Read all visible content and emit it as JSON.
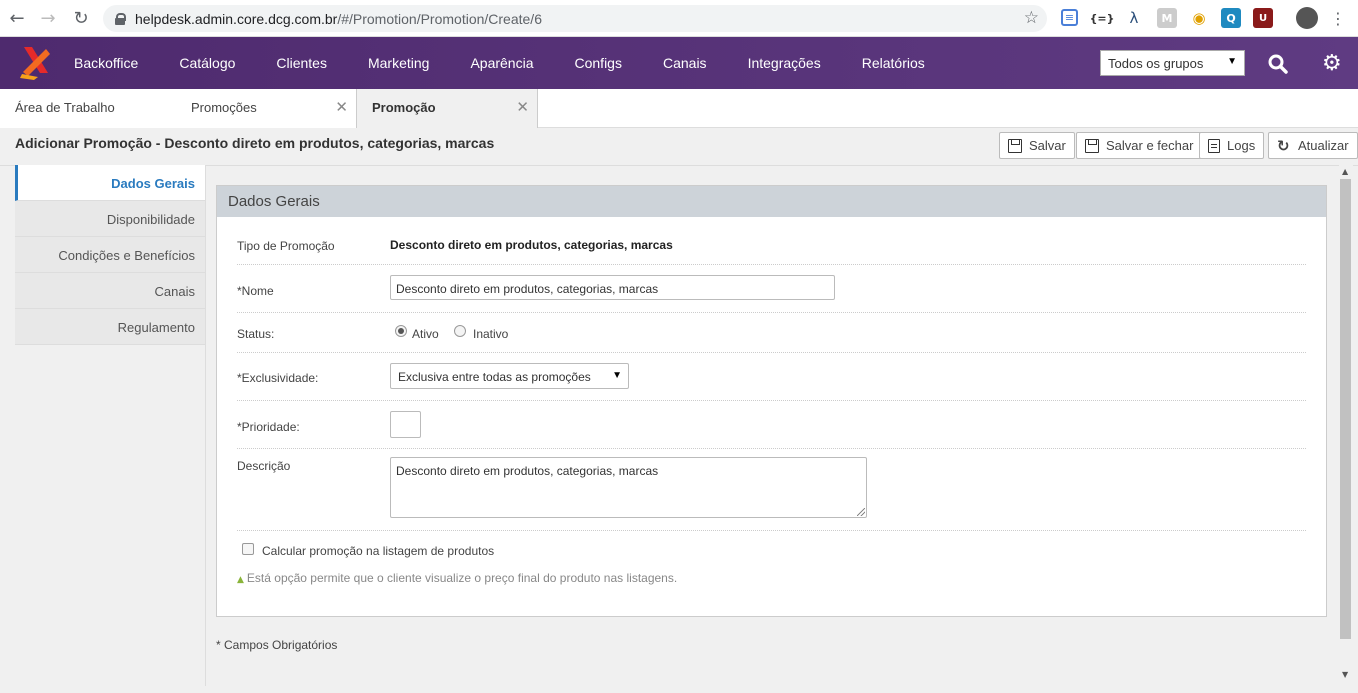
{
  "browser": {
    "url_host": "helpdesk.admin.core.dcg.com.br",
    "url_path": "/#/Promotion/Promotion/Create/6"
  },
  "nav": {
    "items": [
      "Backoffice",
      "Catálogo",
      "Clientes",
      "Marketing",
      "Aparência",
      "Configs",
      "Canais",
      "Integrações",
      "Relatórios"
    ],
    "group_select": "Todos os grupos"
  },
  "tabs": [
    {
      "label": "Área de Trabalho"
    },
    {
      "label": "Promoções"
    },
    {
      "label": "Promoção"
    }
  ],
  "header": {
    "title": "Adicionar Promoção - Desconto direto em produtos, categorias, marcas",
    "buttons": {
      "save": "Salvar",
      "save_close": "Salvar e fechar",
      "logs": "Logs",
      "refresh": "Atualizar"
    }
  },
  "side_menu": [
    "Dados Gerais",
    "Disponibilidade",
    "Condições e Benefícios",
    "Canais",
    "Regulamento"
  ],
  "form": {
    "section_title": "Dados Gerais",
    "tipo_label": "Tipo de Promoção",
    "tipo_value": "Desconto direto em produtos, categorias, marcas",
    "nome_label": "*Nome",
    "nome_value": "Desconto direto em produtos, categorias, marcas",
    "status_label": "Status:",
    "status_active": "Ativo",
    "status_inactive": "Inativo",
    "exclusividade_label": "*Exclusividade:",
    "exclusividade_value": "Exclusiva entre todas as promoções",
    "prioridade_label": "*Prioridade:",
    "prioridade_value": "",
    "descricao_label": "Descrição",
    "descricao_value": "Desconto direto em produtos, categorias, marcas",
    "calc_label": "Calcular promoção na listagem de produtos",
    "calc_hint": "Está opção permite que o cliente visualize o preço final do produto nas listagens."
  },
  "footer_note": "* Campos Obrigatórios",
  "colors": {
    "nav_bg": "#4e2a6e",
    "active_link": "#2a7bbf",
    "logo_orange": "#f26b21",
    "logo_red": "#e52a2a"
  }
}
